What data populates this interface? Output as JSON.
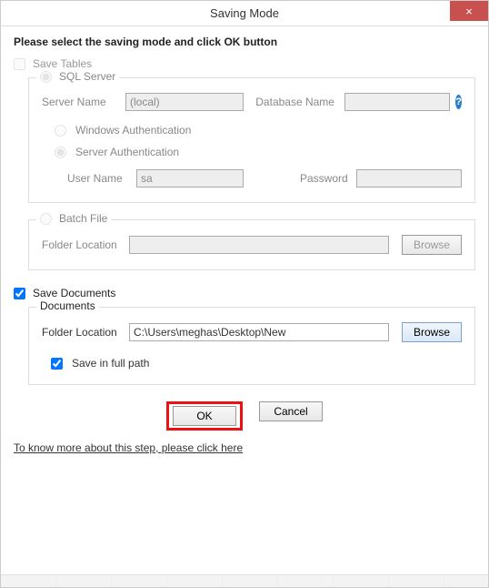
{
  "window": {
    "title": "Saving Mode",
    "close_glyph": "×"
  },
  "headline": "Please select the saving mode and click OK button",
  "save_tables": {
    "label": "Save Tables",
    "checked": false,
    "enabled": false
  },
  "sql": {
    "label": "SQL Server",
    "selected": true,
    "server_name_label": "Server Name",
    "server_name_value": "(local)",
    "db_name_label": "Database Name",
    "db_name_value": "",
    "help_glyph": "?",
    "auth_windows_label": "Windows Authentication",
    "auth_server_label": "Server Authentication",
    "auth_selected": "server",
    "user_label": "User Name",
    "user_value": "sa",
    "pass_label": "Password",
    "pass_value": ""
  },
  "batch": {
    "label": "Batch File",
    "selected": false,
    "folder_label": "Folder Location",
    "folder_value": "",
    "browse_label": "Browse"
  },
  "save_documents": {
    "label": "Save Documents",
    "checked": true
  },
  "documents": {
    "legend": "Documents",
    "folder_label": "Folder Location",
    "folder_value": "C:\\Users\\meghas\\Desktop\\New",
    "browse_label": "Browse",
    "full_path_label": "Save in full path",
    "full_path_checked": true
  },
  "buttons": {
    "ok": "OK",
    "cancel": "Cancel"
  },
  "help_link": "To know more about this step, please click here"
}
